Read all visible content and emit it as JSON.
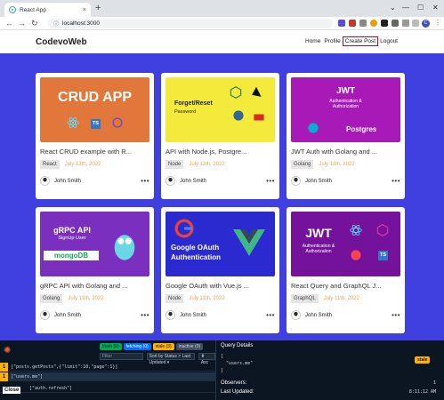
{
  "browser": {
    "tab_title": "React App",
    "tab_close": "×",
    "new_tab": "+",
    "url": "localhost:3000",
    "back": "←",
    "forward": "→",
    "reload": "↻",
    "lock": "ⓘ",
    "profile_initial": "C",
    "menu": "⋮",
    "minimize": "⌄",
    "win_min": "—",
    "win_max": "☐",
    "win_close": "✕"
  },
  "header": {
    "brand": "CodevoWeb",
    "nav": [
      "Home",
      "Profile",
      "Create Post",
      "Logout"
    ]
  },
  "cards": [
    {
      "title": "React CRUD example with R...",
      "tag": "React",
      "date": "July 13th, 2022",
      "author": "John Smith",
      "thumb_text": "CRUD APP",
      "thumb_color": "#e2773b",
      "more": "•••"
    },
    {
      "title": "API with Node.js, Postgre...",
      "tag": "Node",
      "date": "July 11th, 2022",
      "author": "John Smith",
      "thumb_text": "Forget/Reset",
      "thumb_sub": "Password",
      "thumb_color": "#f4ea3c",
      "more": "•••"
    },
    {
      "title": "JWT Auth with Golang and ...",
      "tag": "Golang",
      "date": "July 11th, 2022",
      "author": "John Smith",
      "thumb_text": "JWT",
      "thumb_sub": "Authentication & Authorization",
      "thumb_extra": "Postgres",
      "thumb_color": "#a81ab7",
      "more": "•••"
    },
    {
      "title": "gRPC API with Golang and ...",
      "tag": "Golang",
      "date": "July 11th, 2022",
      "author": "John Smith",
      "thumb_text": "gRPC API",
      "thumb_sub": "SignUp User",
      "thumb_extra": "mongoDB",
      "thumb_color": "#7b2fbf",
      "more": "•••"
    },
    {
      "title": "Google OAuth with Vue.js ...",
      "tag": "Node",
      "date": "July 11th, 2022",
      "author": "John Smith",
      "thumb_text": "Google OAuth",
      "thumb_sub": "Authentication",
      "thumb_color": "#2a2ad0",
      "more": "•••"
    },
    {
      "title": "React Query and GraphQL J...",
      "tag": "GraphQL",
      "date": "July 11th, 2022",
      "author": "John Smith",
      "thumb_text": "JWT",
      "thumb_sub": "Authentication & Authorization",
      "thumb_color": "#75129b",
      "more": "•••"
    }
  ],
  "devtools": {
    "pills": [
      {
        "label": "fresh (0)",
        "color": "#00ab52"
      },
      {
        "label": "fetching (0)",
        "color": "#006bff"
      },
      {
        "label": "stale (3)",
        "color": "#ffb200"
      },
      {
        "label": "inactive (0)",
        "color": "#3f4e60"
      }
    ],
    "filter_placeholder": "Filter",
    "sort_label": "Sort by Status > Last Updated ▾",
    "asc_label": "⬆ Asc",
    "queries": [
      {
        "count": "1",
        "key": "[\"posts.getPosts\",{\"limit\":10,\"page\":1}]"
      },
      {
        "count": "1",
        "key": "[\"users.me\"]"
      },
      {
        "count": "1",
        "key": "[\"auth.refresh\"]"
      }
    ],
    "close_label": "Close",
    "details_header": "Query Details",
    "details_code": [
      "[",
      "  \"users.me\"",
      "]"
    ],
    "details_status": "stale",
    "observers_label": "Observers:",
    "observers_value": "1",
    "last_updated_label": "Last Updated:",
    "last_updated_value": "8:11:12 AM"
  }
}
